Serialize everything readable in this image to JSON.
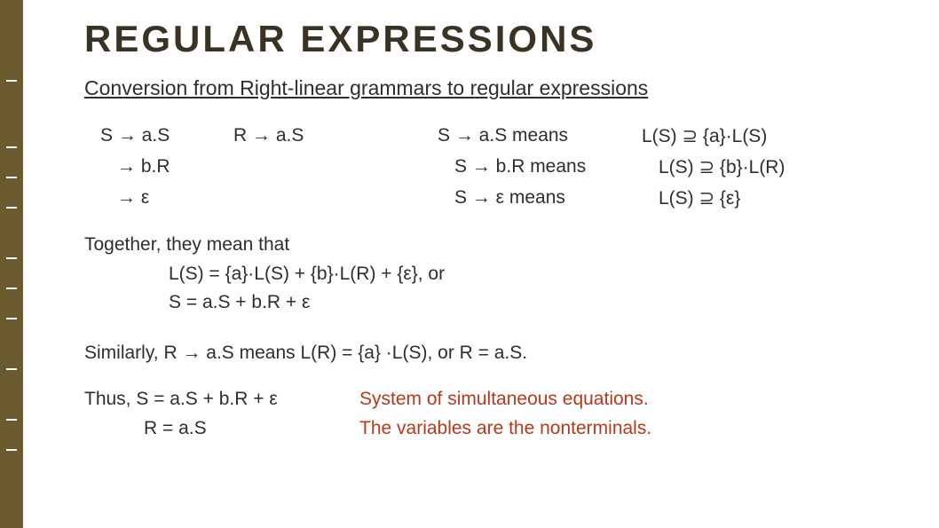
{
  "title": "REGULAR EXPRESSIONS",
  "subtitle": "Conversion from Right-linear grammars to regular expressions",
  "rows": [
    {
      "c1": "S → a.S",
      "c2": "R → a.S",
      "c3": "S → a.S  means",
      "c4": "L(S) ⊇ {a}·L(S)"
    },
    {
      "c1": "→ b.R",
      "c2": "",
      "c3": "S → b.R means",
      "c4": "L(S) ⊇  {b}·L(R)"
    },
    {
      "c1": "→ ε",
      "c2": "",
      "c3": "S → ε   means",
      "c4": "L(S) ⊇ {ε}"
    }
  ],
  "together": "Together, they mean that",
  "eq1": "L(S) = {a}·L(S) + {b}·L(R) + {ε}, or",
  "eq2": "S = a.S + b.R + ε",
  "similarly": "Similarly, R → a.S means L(R) = {a} ·L(S), or R = a.S.",
  "thus1": "Thus,  S = a.S + b.R + ε",
  "thus2": "R = a.S",
  "sys1": "System of simultaneous equations.",
  "sys2": "The variables are the nonterminals."
}
